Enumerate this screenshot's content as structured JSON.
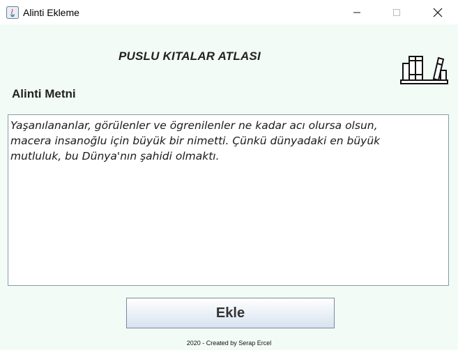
{
  "window": {
    "title": "Alinti Ekleme",
    "icon": "java-icon",
    "controls": [
      "minimize-icon",
      "maximize-icon",
      "close-icon"
    ]
  },
  "header": {
    "title": "PUSLU KITALAR ATLASI",
    "icon": "books-icon"
  },
  "form": {
    "label": "Alinti Metni",
    "text_value": "Yaşanılananlar, görülenler ve ögrenilenler ne kadar acı olursa olsun,\nmacera insanoğlu için büyük bir nimetti. Çünkü dünyadaki en büyük\nmutluluk, bu Dünya'nın şahidi olmaktı.",
    "submit_label": "Ekle"
  },
  "footer": {
    "credit": "2020 - Created by Serap Ercel"
  }
}
